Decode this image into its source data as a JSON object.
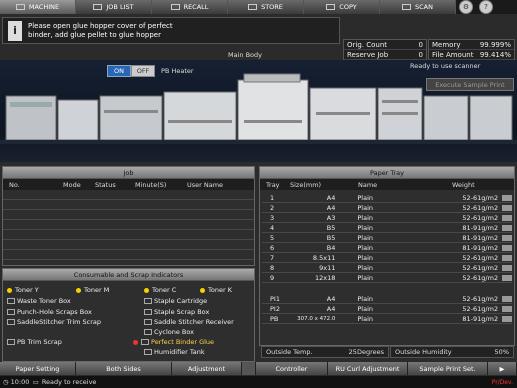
{
  "tabs": [
    "MACHINE",
    "JOB LIST",
    "RECALL",
    "STORE",
    "COPY",
    "SCAN"
  ],
  "message": {
    "line1": "Please open glue hopper cover of perfect",
    "line2": "binder, add glue pellet to glue hopper"
  },
  "status": {
    "orig_count_label": "Orig. Count",
    "orig_count_value": "0",
    "reserve_job_label": "Reserve Job",
    "reserve_job_value": "0",
    "memory_label": "Memory",
    "memory_value": "99.999%",
    "file_amount_label": "File Amount",
    "file_amount_value": "99.414%"
  },
  "main_body": "Main Body",
  "pb_heater": {
    "on": "ON",
    "off": "OFF",
    "label": "PB Heater"
  },
  "ready_text": "Ready to use scanner",
  "execute_sample_print": "Execute Sample Print",
  "job_panel": {
    "title": "Job",
    "columns": [
      "No.",
      "Mode",
      "Status",
      "Minute(S)",
      "User Name"
    ]
  },
  "consumables": {
    "title": "Consumable and Scrap Indicators",
    "items": [
      "Toner Y",
      "Toner M",
      "Toner C",
      "Toner K",
      "Waste Toner Box",
      "Staple Cartridge",
      "Punch-Hole Scraps Box",
      "Staple Scrap Box",
      "SaddleStitcher Trim Scrap",
      "Saddle Stitcher Receiver",
      "Cyclone Box",
      "PB Trim Scrap",
      "Perfect Binder Glue",
      "Humidifier Tank"
    ]
  },
  "paper_tray": {
    "title": "Paper Tray",
    "columns": [
      "Tray",
      "Size(mm)",
      "Name",
      "Weight"
    ],
    "rows": [
      {
        "tray": "1",
        "size": "A4",
        "name": "Plain",
        "weight": "52-61g/m2"
      },
      {
        "tray": "2",
        "size": "A4",
        "name": "Plain",
        "weight": "52-61g/m2"
      },
      {
        "tray": "3",
        "size": "A3",
        "name": "Plain",
        "weight": "52-61g/m2"
      },
      {
        "tray": "4",
        "size": "B5",
        "name": "Plain",
        "weight": "81-91g/m2"
      },
      {
        "tray": "5",
        "size": "B5",
        "name": "Plain",
        "weight": "81-91g/m2"
      },
      {
        "tray": "6",
        "size": "B4",
        "name": "Plain",
        "weight": "81-91g/m2"
      },
      {
        "tray": "7",
        "size": "8.5x11",
        "name": "Plain",
        "weight": "52-61g/m2"
      },
      {
        "tray": "8",
        "size": "9x11",
        "name": "Plain",
        "weight": "52-61g/m2"
      },
      {
        "tray": "9",
        "size": "12x18",
        "name": "Plain",
        "weight": "52-61g/m2"
      },
      {
        "tray": "PI1",
        "size": "A4",
        "name": "Plain",
        "weight": "52-61g/m2"
      },
      {
        "tray": "PI2",
        "size": "A4",
        "name": "Plain",
        "weight": "52-61g/m2"
      },
      {
        "tray": "PB",
        "size": "307.0 x 472.0",
        "name": "Plain",
        "weight": "81-91g/m2"
      }
    ],
    "outside_temp_label": "Outside Temp.",
    "outside_temp_value": "25Degrees",
    "outside_humidity_label": "Outside Humidity",
    "outside_humidity_value": "50%"
  },
  "bottom_buttons": [
    "Paper Setting",
    "Both Sides",
    "Adjustment",
    "Controller",
    "RU Curl Adjustment",
    "Sample Print Set."
  ],
  "statusbar": {
    "time": "10:00",
    "text": "Ready to receive",
    "right": "Pr/Dev."
  }
}
